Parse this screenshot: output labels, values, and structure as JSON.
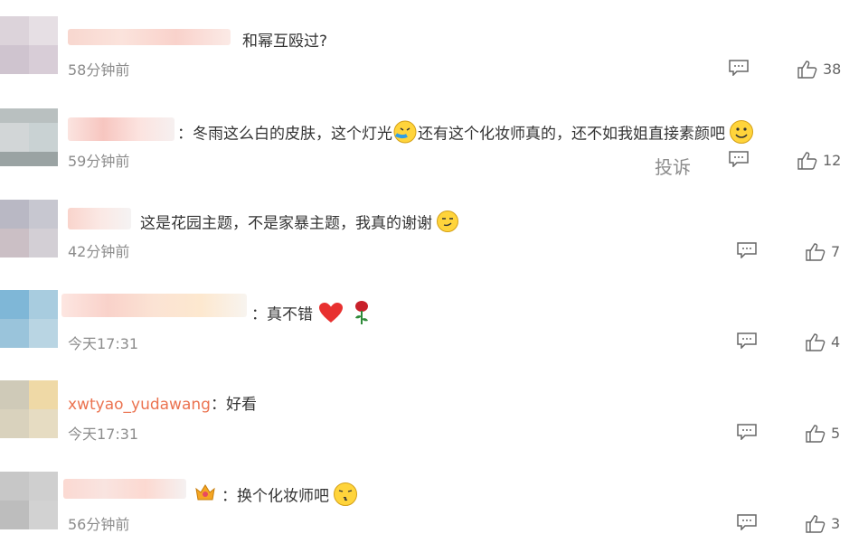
{
  "comments": [
    {
      "text": "和幂互殴过?",
      "time": "58分钟前",
      "likes": "38"
    },
    {
      "text": "：冬雨这么白的皮肤，这个灯光",
      "text2": "还有这个化妆师真的，还不如我姐直接素颜吧",
      "time": "59分钟前",
      "likes": "12",
      "report": "投诉"
    },
    {
      "text": "这是花园主题，不是家暴主题，我真的谢谢",
      "time": "42分钟前",
      "likes": "7"
    },
    {
      "text": "：真不错",
      "time": "今天17:31",
      "likes": "4"
    },
    {
      "username": "xwtyao_yudawang",
      "text": "：好看",
      "time": "今天17:31",
      "likes": "5"
    },
    {
      "text": "：换个化妆师吧",
      "time": "56分钟前",
      "likes": "3"
    }
  ],
  "colors": {
    "username": "#eb7350",
    "time": "#8c8c8c",
    "icon": "#666666"
  },
  "icons": {
    "reply": "comment-bubble-icon",
    "like": "thumbs-up-icon"
  }
}
